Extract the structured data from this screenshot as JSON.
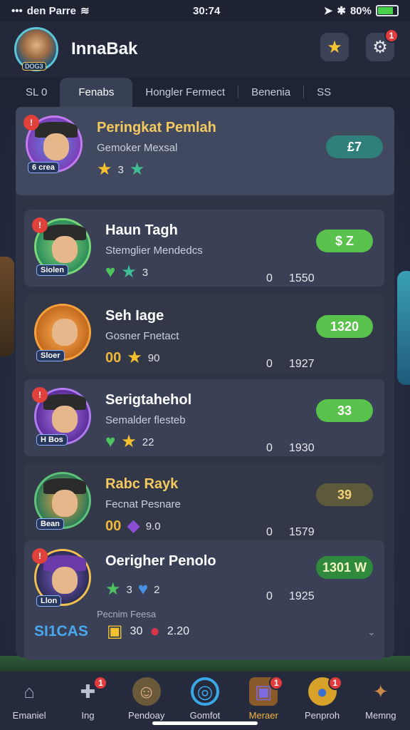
{
  "status_bar": {
    "carrier": "den Parre",
    "time": "30:74",
    "battery": "80%",
    "battery_level": 0.8
  },
  "header": {
    "username": "InnaBak",
    "avatar_tag": "DOG3",
    "star_icon": "star-icon",
    "settings_icon": "gear-icon",
    "settings_badge": "1"
  },
  "tabs": [
    {
      "label": "SL 0"
    },
    {
      "label": "Fenabs"
    },
    {
      "label": "Hongler Fermect"
    },
    {
      "label": "Benenia"
    },
    {
      "label": "SS"
    }
  ],
  "featured": {
    "title": "Peringkat Pemlah",
    "subtitle": "Gemoker Mexsal",
    "level": "6 crea",
    "stat": "3",
    "score": "£7"
  },
  "entries": [
    {
      "title": "Haun Tagh",
      "subtitle": "Stemglier Mendedcs",
      "level": "Siolen",
      "stat": "3",
      "num_a": "0",
      "num_b": "1550",
      "score": "$ Z"
    },
    {
      "title": "Seh Iage",
      "subtitle": "Gosner Fnetact",
      "level": "Sloer",
      "badge_text": "00",
      "stat": "90",
      "num_a": "0",
      "num_b": "1927",
      "score": "1320"
    },
    {
      "title": "Serigtahehol",
      "subtitle": "Semalder flesteb",
      "level": "H Bos",
      "stat": "22",
      "num_a": "0",
      "num_b": "1930",
      "score": "33"
    },
    {
      "title": "Rabc Rayk",
      "subtitle": "Fecnat Pesnare",
      "level": "Bean",
      "badge_text": "00",
      "stat": "9.0",
      "num_a": "0",
      "num_b": "1579",
      "score": "39"
    },
    {
      "title": "Oerigher Penolo",
      "subtitle": "",
      "level": "Llon",
      "stat_a": "3",
      "stat": "2",
      "num_a": "0",
      "num_b": "1925",
      "score": "1301 W"
    }
  ],
  "footer_panel": {
    "label": "Pecnim Feesa",
    "code": "SI1CAS",
    "item_a": "30",
    "item_b": "2.20"
  },
  "bottom_nav": [
    {
      "label": "Emaniel",
      "icon": "home-icon"
    },
    {
      "label": "Ing",
      "icon": "puzzle-icon",
      "badge": "1"
    },
    {
      "label": "Pendoay",
      "icon": "character-icon"
    },
    {
      "label": "Gomfot",
      "icon": "ring-icon"
    },
    {
      "label": "Meraer",
      "icon": "chest-icon",
      "badge": "1",
      "active": true
    },
    {
      "label": "Penproh",
      "icon": "coin-icon",
      "badge": "1"
    },
    {
      "label": "Memng",
      "icon": "box-icon"
    }
  ],
  "colors": {
    "accent_gold": "#f4c95e",
    "accent_green": "#58c24c",
    "accent_teal": "#2f7f7a",
    "alert_red": "#e23b3b"
  }
}
